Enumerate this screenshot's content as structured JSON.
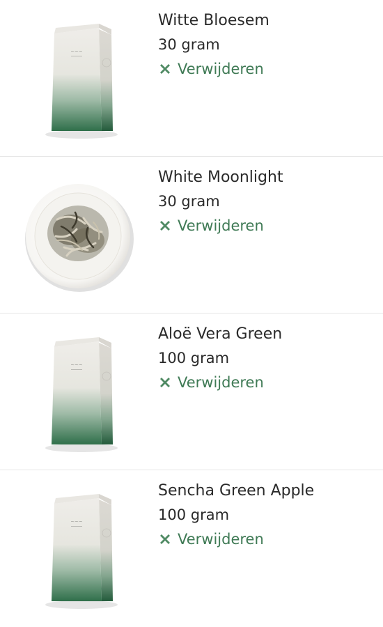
{
  "accent_color": "#3f7a55",
  "items": [
    {
      "name": "Witte Bloesem",
      "weight": "30 gram",
      "remove_label": "Verwijderen",
      "image": "tea-bag-icon"
    },
    {
      "name": "White Moonlight",
      "weight": "30 gram",
      "remove_label": "Verwijderen",
      "image": "tea-leaves-plate"
    },
    {
      "name": "Aloë Vera Green",
      "weight": "100 gram",
      "remove_label": "Verwijderen",
      "image": "tea-bag-icon"
    },
    {
      "name": "Sencha Green Apple",
      "weight": "100 gram",
      "remove_label": "Verwijderen",
      "image": "tea-bag-icon"
    }
  ]
}
